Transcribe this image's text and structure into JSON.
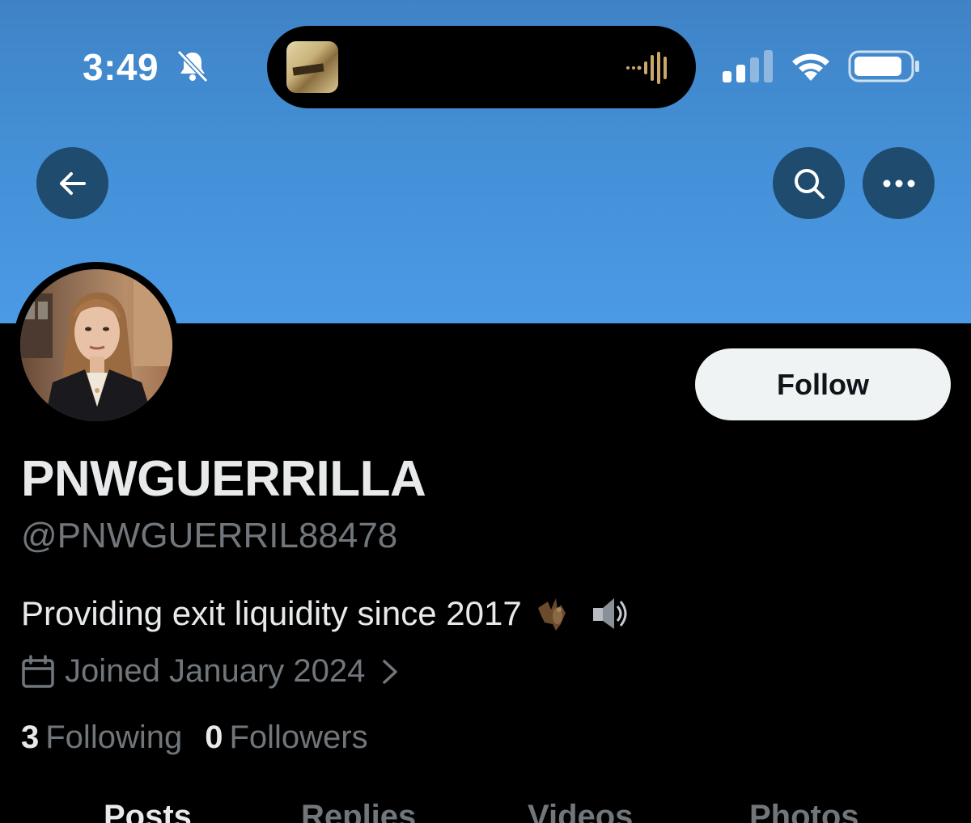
{
  "status_bar": {
    "time": "3:49",
    "icons": [
      "bell-slash-icon",
      "cellular-signal-icon",
      "wifi-icon",
      "battery-icon"
    ],
    "dynamic_island": {
      "icons": [
        "album-art-icon",
        "audio-waveform-icon"
      ]
    }
  },
  "header": {
    "banner_color": "#4a97e2",
    "buttons": [
      "back-arrow-icon",
      "search-icon",
      "more-icon"
    ]
  },
  "profile": {
    "display_name": "PNWGUERRILLA",
    "handle": "@PNWGUERRIL88478",
    "bio": "Providing exit liquidity since 2017",
    "bio_emojis": [
      "bat-emoji",
      "speaker-emoji"
    ],
    "joined": "Joined January 2024",
    "following_count": "3",
    "following_label": "Following",
    "followers_count": "0",
    "followers_label": "Followers",
    "follow_button_label": "Follow"
  },
  "tabs": [
    {
      "label": "Posts",
      "active": true
    },
    {
      "label": "Replies",
      "active": false
    },
    {
      "label": "Videos",
      "active": false
    },
    {
      "label": "Photos",
      "active": false
    }
  ],
  "colors": {
    "background": "#000000",
    "primary_text": "#e7e9ea",
    "secondary_text": "#71767b",
    "button_bg": "#eff3f4",
    "nav_button_bg": "#1f4b6e"
  }
}
